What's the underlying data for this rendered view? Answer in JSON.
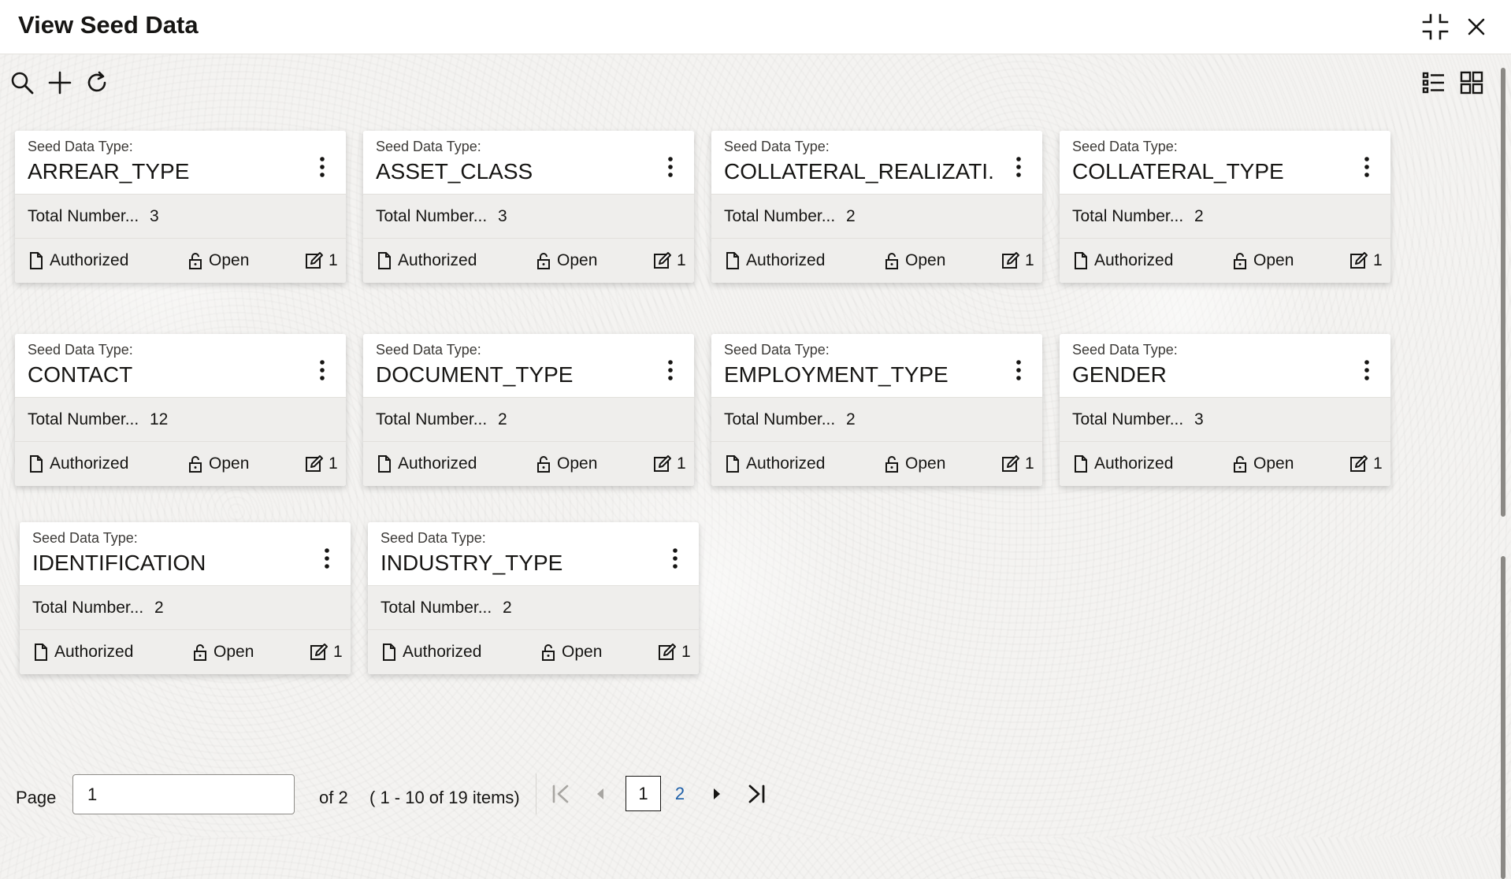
{
  "header": {
    "title": "View Seed Data"
  },
  "toolbar": {
    "search_icon": "search-icon",
    "add_icon": "plus-icon",
    "refresh_icon": "refresh-icon",
    "list_view_icon": "list-view-icon",
    "grid_view_icon": "grid-view-icon"
  },
  "card_labels": {
    "caption": "Seed Data Type:",
    "count_label": "Total Number..."
  },
  "cards": [
    {
      "title": "ARREAR_TYPE",
      "count": "3",
      "status": "Authorized",
      "lock": "Open",
      "edits": "1"
    },
    {
      "title": "ASSET_CLASS",
      "count": "3",
      "status": "Authorized",
      "lock": "Open",
      "edits": "1"
    },
    {
      "title": "COLLATERAL_REALIZATI...",
      "count": "2",
      "status": "Authorized",
      "lock": "Open",
      "edits": "1"
    },
    {
      "title": "COLLATERAL_TYPE",
      "count": "2",
      "status": "Authorized",
      "lock": "Open",
      "edits": "1"
    },
    {
      "title": "CONTACT",
      "count": "12",
      "status": "Authorized",
      "lock": "Open",
      "edits": "1"
    },
    {
      "title": "DOCUMENT_TYPE",
      "count": "2",
      "status": "Authorized",
      "lock": "Open",
      "edits": "1"
    },
    {
      "title": "EMPLOYMENT_TYPE",
      "count": "2",
      "status": "Authorized",
      "lock": "Open",
      "edits": "1"
    },
    {
      "title": "GENDER",
      "count": "3",
      "status": "Authorized",
      "lock": "Open",
      "edits": "1"
    },
    {
      "title": "IDENTIFICATION",
      "count": "2",
      "status": "Authorized",
      "lock": "Open",
      "edits": "1"
    },
    {
      "title": "INDUSTRY_TYPE",
      "count": "2",
      "status": "Authorized",
      "lock": "Open",
      "edits": "1"
    }
  ],
  "pagination": {
    "page_label": "Page",
    "page_value": "1",
    "of_text": "of 2",
    "items_text": "( 1 - 10 of 19 items)",
    "current_page": "1",
    "next_page": "2"
  },
  "colors": {
    "link": "#1d5fa8",
    "text": "#161513",
    "card_section": "#efeeec"
  }
}
